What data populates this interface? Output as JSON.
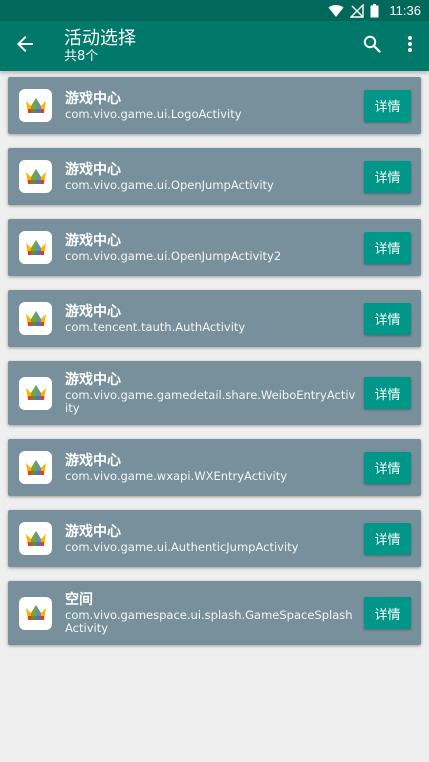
{
  "status_bar": {
    "time": "11:36",
    "icons": [
      "wifi-icon",
      "no-signal-icon",
      "battery-icon"
    ]
  },
  "app_bar": {
    "title": "活动选择",
    "subtitle": "共8个",
    "back_icon": "arrow-back-icon",
    "search_icon": "search-icon",
    "more_icon": "more-vert-icon",
    "colors": {
      "primary": "#00796b",
      "primary_dark": "#00695c",
      "card": "#78909c",
      "button": "#009688"
    }
  },
  "activities": [
    {
      "app": "游戏中心",
      "activity": "com.vivo.game.ui.LogoActivity",
      "button": "详情"
    },
    {
      "app": "游戏中心",
      "activity": "com.vivo.game.ui.OpenJumpActivity",
      "button": "详情"
    },
    {
      "app": "游戏中心",
      "activity": "com.vivo.game.ui.OpenJumpActivity2",
      "button": "详情"
    },
    {
      "app": "游戏中心",
      "activity": "com.tencent.tauth.AuthActivity",
      "button": "详情"
    },
    {
      "app": "游戏中心",
      "activity": "com.vivo.game.gamedetail.share.WeiboEntryActivity",
      "button": "详情"
    },
    {
      "app": "游戏中心",
      "activity": "com.vivo.game.wxapi.WXEntryActivity",
      "button": "详情"
    },
    {
      "app": "游戏中心",
      "activity": "com.vivo.game.ui.AuthenticJumpActivity",
      "button": "详情"
    },
    {
      "app": "空间",
      "activity": "com.vivo.gamespace.ui.splash.GameSpaceSplashActivity",
      "button": "详情"
    }
  ]
}
